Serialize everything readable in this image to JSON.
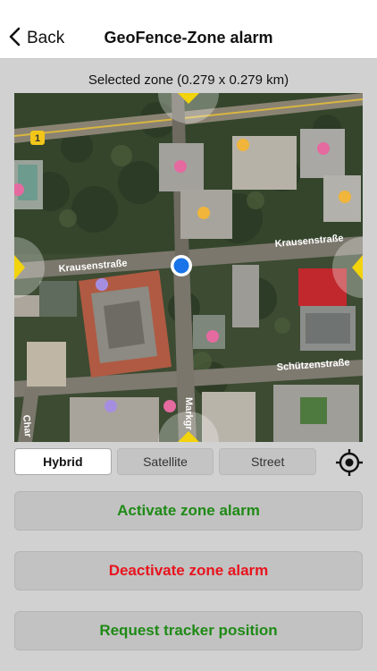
{
  "nav": {
    "back_label": "Back",
    "title": "GeoFence-Zone alarm"
  },
  "zone": {
    "label": "Selected zone (0.279 x 0.279 km)"
  },
  "map": {
    "streets": {
      "krausen_right": "Krausenstraße",
      "krausen_left": "Krausenstraße",
      "schuetzen": "Schützenstraße",
      "markgrafen": "Markgr",
      "charlotten": "Char"
    },
    "badge_number": "1"
  },
  "map_types": {
    "hybrid": "Hybrid",
    "satellite": "Satellite",
    "street": "Street",
    "selected": "Hybrid"
  },
  "actions": {
    "activate": "Activate zone alarm",
    "deactivate": "Deactivate zone alarm",
    "request": "Request tracker position"
  },
  "colors": {
    "activate": "#1f8a16",
    "deactivate": "#e8141e",
    "request": "#1f8a16",
    "handle": "#f2d30c",
    "location_dot": "#1a73e8"
  }
}
